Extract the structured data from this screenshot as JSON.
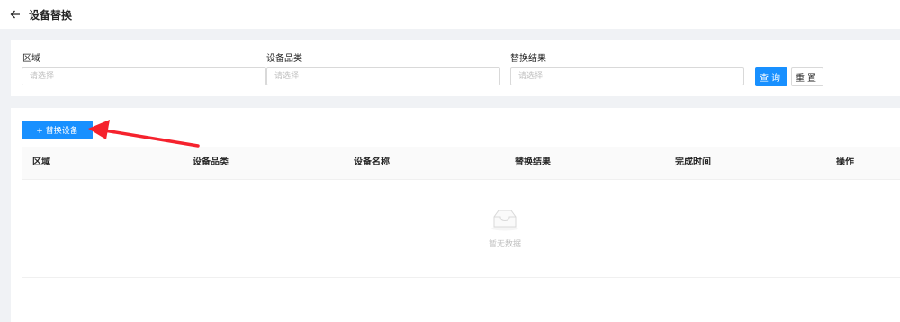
{
  "header": {
    "title": "设备替换",
    "back_icon": "arrow-left-icon"
  },
  "filters": {
    "region": {
      "label": "区域",
      "placeholder": "请选择"
    },
    "category": {
      "label": "设备品类",
      "placeholder": "请选择"
    },
    "result": {
      "label": "替换结果",
      "placeholder": "请选择"
    },
    "query_label": "查询",
    "reset_label": "重置"
  },
  "toolbar": {
    "add_label": "+ 替换设备"
  },
  "table": {
    "columns": [
      "区域",
      "设备品类",
      "设备名称",
      "替换结果",
      "完成时间",
      "操作"
    ],
    "empty_text": "暂无数据"
  },
  "colors": {
    "primary": "#1890ff",
    "annotation_arrow": "#f5222d",
    "background": "#f0f2f5"
  }
}
